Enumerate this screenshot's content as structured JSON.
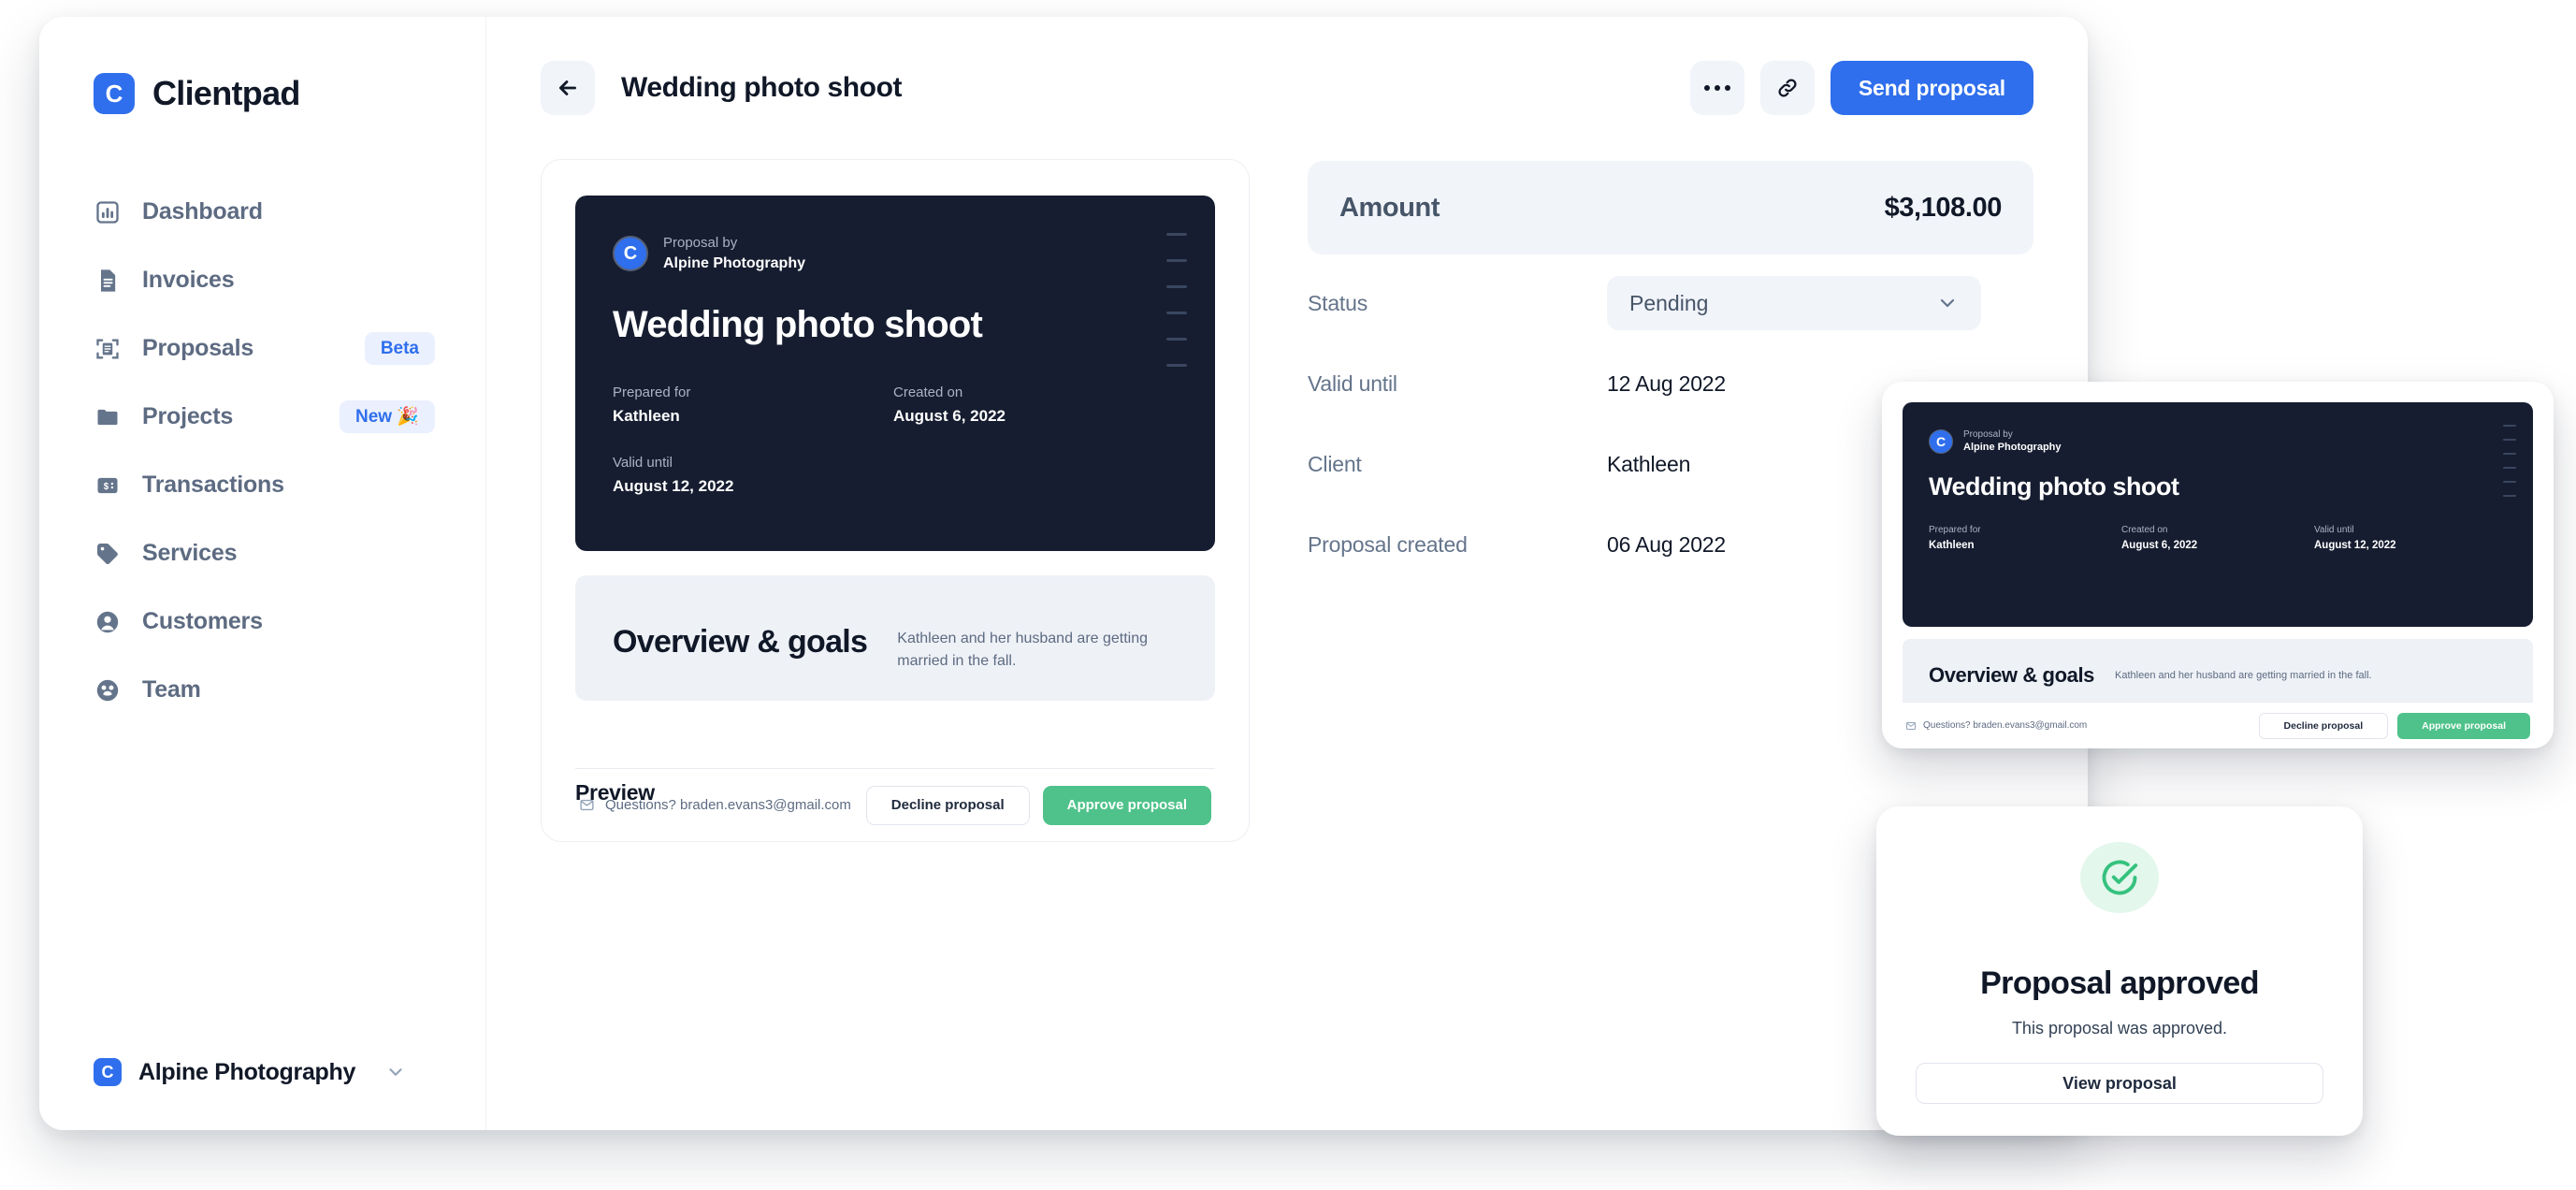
{
  "brand": {
    "logo_letter": "C",
    "name": "Clientpad"
  },
  "sidebar": {
    "items": [
      {
        "label": "Dashboard",
        "icon": "chart-box-icon",
        "badge": null
      },
      {
        "label": "Invoices",
        "icon": "document-icon",
        "badge": null
      },
      {
        "label": "Proposals",
        "icon": "proposal-scan-icon",
        "badge": "Beta"
      },
      {
        "label": "Projects",
        "icon": "folder-icon",
        "badge": "New 🎉"
      },
      {
        "label": "Transactions",
        "icon": "money-card-icon",
        "badge": null
      },
      {
        "label": "Services",
        "icon": "tag-icon",
        "badge": null
      },
      {
        "label": "Customers",
        "icon": "person-circle-icon",
        "badge": null
      },
      {
        "label": "Team",
        "icon": "team-circle-icon",
        "badge": null
      }
    ],
    "workspace": {
      "logo_letter": "C",
      "name": "Alpine Photography"
    }
  },
  "topbar": {
    "back_icon": "arrow-left-icon",
    "title": "Wedding photo shoot",
    "more_icon": "more-horizontal-icon",
    "link_icon": "link-icon",
    "send_label": "Send proposal"
  },
  "preview": {
    "label": "Preview",
    "doc": {
      "avatar_letter": "C",
      "by_label": "Proposal by",
      "by_name": "Alpine Photography",
      "title": "Wedding photo shoot",
      "prepared_for_label": "Prepared for",
      "prepared_for_value": "Kathleen",
      "created_on_label": "Created on",
      "created_on_value": "August 6, 2022",
      "valid_until_label": "Valid until",
      "valid_until_value": "August 12, 2022",
      "overview_title": "Overview & goals",
      "overview_text": "Kathleen and her husband are getting married in the fall.",
      "questions_text": "Questions? braden.evans3@gmail.com",
      "decline_label": "Decline proposal",
      "approve_label": "Approve proposal"
    }
  },
  "details": {
    "amount_label": "Amount",
    "amount_value": "$3,108.00",
    "status_label": "Status",
    "status_value": "Pending",
    "rows": [
      {
        "label": "Valid until",
        "value": "12 Aug 2022"
      },
      {
        "label": "Client",
        "value": "Kathleen"
      },
      {
        "label": "Proposal created",
        "value": "06 Aug 2022"
      }
    ]
  },
  "floating_doc": {
    "avatar_letter": "C",
    "by_label": "Proposal by",
    "by_name": "Alpine Photography",
    "title": "Wedding photo shoot",
    "prepared_for_label": "Prepared for",
    "prepared_for_value": "Kathleen",
    "created_on_label": "Created on",
    "created_on_value": "August 6, 2022",
    "valid_until_label": "Valid until",
    "valid_until_value": "August 12, 2022",
    "overview_title": "Overview & goals",
    "overview_text": "Kathleen and her husband are getting married in the fall.",
    "questions_text": "Questions? braden.evans3@gmail.com",
    "decline_label": "Decline proposal",
    "approve_label": "Approve proposal"
  },
  "approved": {
    "icon": "check-circle-icon",
    "title": "Proposal approved",
    "subtitle": "This proposal was approved.",
    "button_label": "View proposal"
  },
  "colors": {
    "brand_blue": "#2f6fed",
    "badge_bg": "#eaf0fe",
    "dark_panel": "#161d30",
    "green": "#4ec28a",
    "success_green": "#35c27e",
    "success_bg": "#e3f7ec"
  }
}
